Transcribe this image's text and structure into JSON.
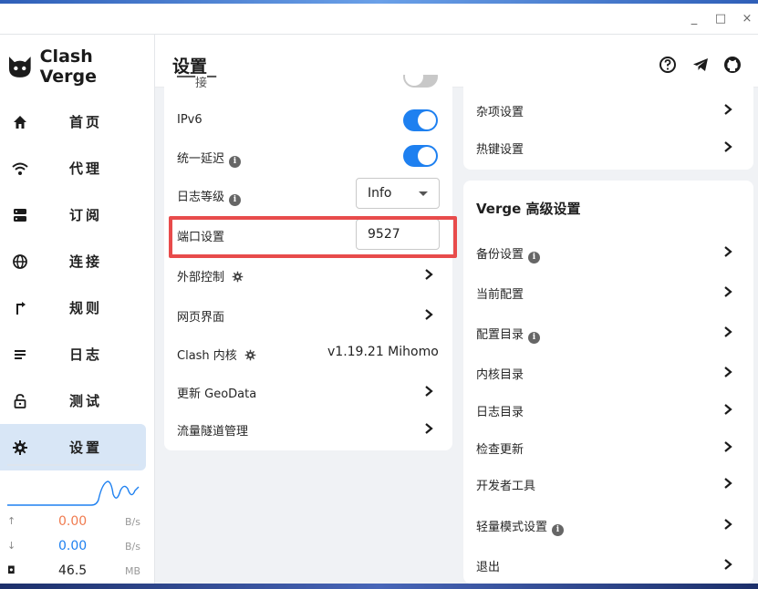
{
  "app": {
    "title": "Clash Verge"
  },
  "window": {
    "minimize": "_",
    "maximize": "□",
    "close": "×"
  },
  "header": {
    "title": "设置"
  },
  "sidebar": {
    "items": [
      {
        "label": "首页",
        "icon": "home-icon"
      },
      {
        "label": "代理",
        "icon": "wifi-icon"
      },
      {
        "label": "订阅",
        "icon": "storage-icon"
      },
      {
        "label": "连接",
        "icon": "globe-icon"
      },
      {
        "label": "规则",
        "icon": "route-icon"
      },
      {
        "label": "日志",
        "icon": "list-icon"
      },
      {
        "label": "测试",
        "icon": "lock-icon"
      },
      {
        "label": "设置",
        "icon": "gear-icon",
        "active": true
      }
    ]
  },
  "traffic": {
    "upload": {
      "value": "0.00",
      "unit": "B/s",
      "color": "#f07b4f"
    },
    "download": {
      "value": "0.00",
      "unit": "B/s",
      "color": "#1e80f0"
    },
    "memory": {
      "value": "46.5",
      "unit": "MB"
    }
  },
  "left_card": {
    "partial_label": "▔▔接▔",
    "ipv6": {
      "label": "IPv6",
      "enabled": true
    },
    "unified_delay": {
      "label": "统一延迟",
      "enabled": true
    },
    "log_level": {
      "label": "日志等级",
      "value": "Info"
    },
    "port": {
      "label": "端口设置",
      "value": "9527"
    },
    "external": {
      "label": "外部控制"
    },
    "web_ui": {
      "label": "网页界面"
    },
    "core": {
      "label": "Clash 内核",
      "value": "v1.19.21 Mihomo"
    },
    "geodata": {
      "label": "更新 GeoData"
    },
    "tunnel": {
      "label": "流量隧道管理"
    }
  },
  "right_top_card": {
    "misc": {
      "label": "杂项设置"
    },
    "hotkey": {
      "label": "热键设置"
    }
  },
  "right_card": {
    "title": "Verge 高级设置",
    "items": [
      {
        "label": "备份设置",
        "info": true
      },
      {
        "label": "当前配置",
        "info": false
      },
      {
        "label": "配置目录",
        "info": true
      },
      {
        "label": "内核目录",
        "info": false
      },
      {
        "label": "日志目录",
        "info": false
      },
      {
        "label": "检查更新",
        "info": false
      },
      {
        "label": "开发者工具",
        "info": false
      },
      {
        "label": "轻量模式设置",
        "info": true
      },
      {
        "label": "退出",
        "info": false
      }
    ]
  },
  "colors": {
    "accent": "#1e80f0",
    "highlight": "#e84b4b"
  }
}
